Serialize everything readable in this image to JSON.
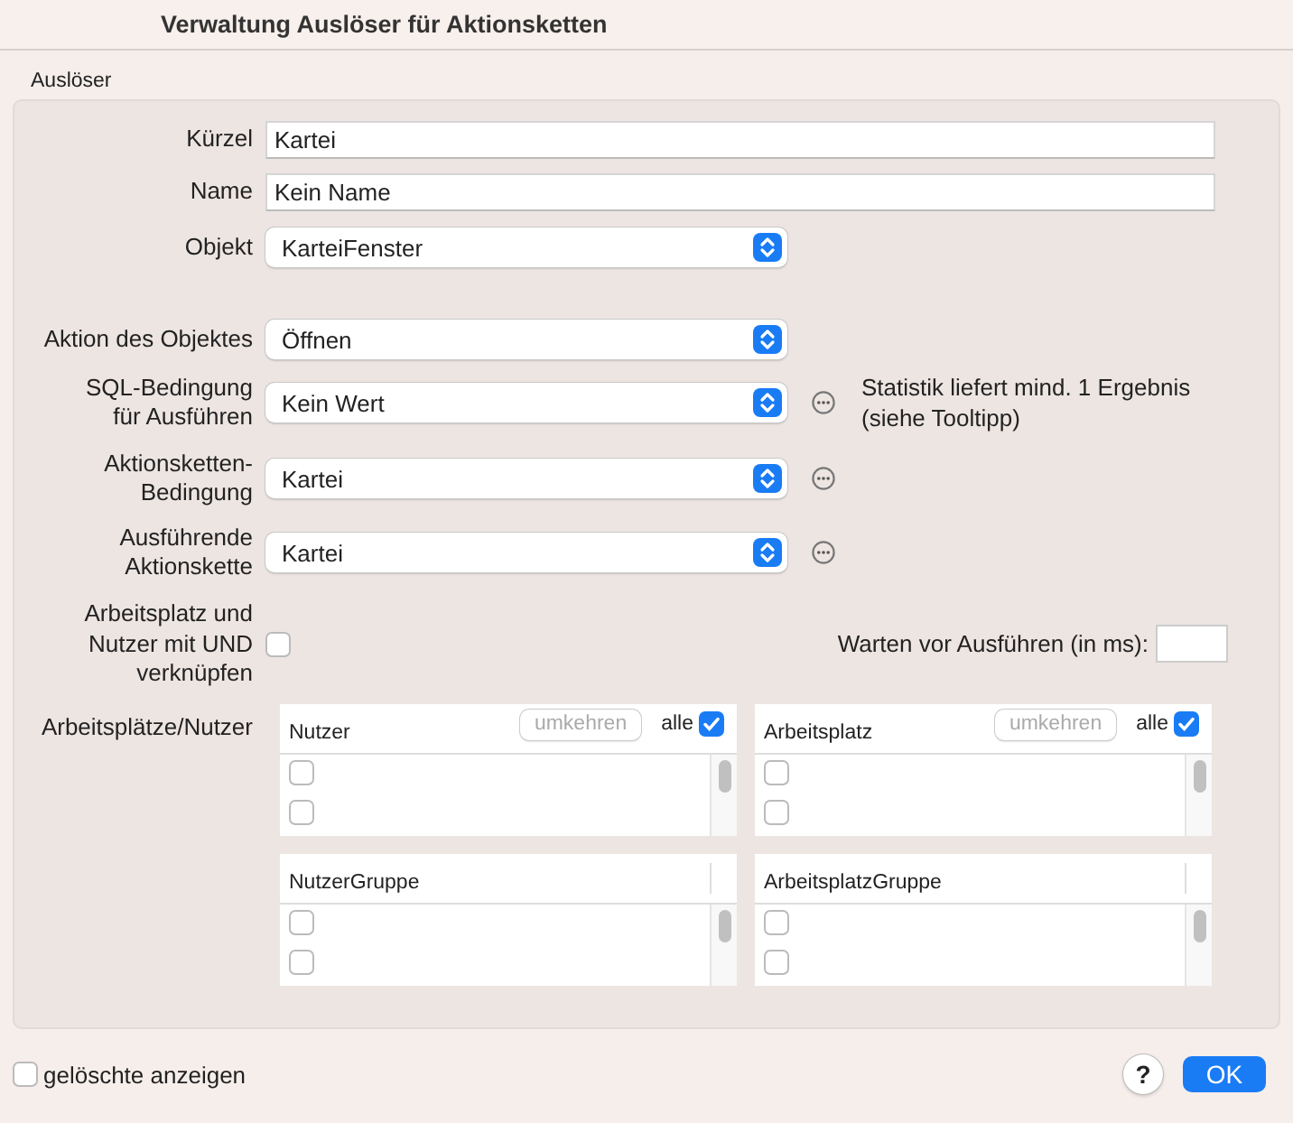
{
  "window": {
    "title": "Verwaltung Auslöser für Aktionsketten"
  },
  "section": {
    "title": "Auslöser"
  },
  "fields": [
    {
      "kind": "text",
      "label": "Kürzel",
      "value": "Kartei",
      "more_button": false
    },
    {
      "kind": "text",
      "label": "Name",
      "value": "Kein Name",
      "more_button": false
    },
    {
      "kind": "select",
      "label": "Objekt",
      "value": "KarteiFenster",
      "more_button": false
    },
    {
      "kind": "select",
      "label": "Aktion des Objektes",
      "value": "Öffnen",
      "more_button": false
    },
    {
      "kind": "select",
      "label": "SQL-Bedingung\nfür Ausführen",
      "value": "Kein Wert",
      "more_button": true,
      "note": "Statistik liefert mind. 1 Ergebnis (siehe Tooltipp)"
    },
    {
      "kind": "select",
      "label": "Aktionsketten-Bedingung",
      "value": "Kartei",
      "more_button": true
    },
    {
      "kind": "select",
      "label": "Ausführende Aktionskette",
      "value": "Kartei",
      "more_button": true
    }
  ],
  "and_option": {
    "label": "Arbeitsplatz und Nutzer mit UND verknüpfen",
    "checked": false
  },
  "wait": {
    "label": "Warten vor Ausführen (in ms):"
  },
  "lists_label": "Arbeitsplätze/Nutzer",
  "lists": [
    {
      "title": "Nutzer",
      "invert_button": {
        "label": "umkehren",
        "disabled": true
      },
      "all": {
        "label": "alle",
        "checked": true
      },
      "rows": [
        {
          "checked": false
        },
        {
          "checked": false
        }
      ]
    },
    {
      "title": "Arbeitsplatz",
      "invert_button": {
        "label": "umkehren",
        "disabled": true
      },
      "all": {
        "label": "alle",
        "checked": true
      },
      "rows": [
        {
          "checked": false
        },
        {
          "checked": false
        }
      ]
    },
    {
      "title": "NutzerGruppe",
      "rows": [
        {
          "checked": false
        },
        {
          "checked": false
        }
      ]
    },
    {
      "title": "ArbeitsplatzGruppe",
      "rows": [
        {
          "checked": false
        },
        {
          "checked": false
        }
      ]
    }
  ],
  "footer": {
    "show_deleted": {
      "label": "gelöschte anzeigen",
      "checked": false
    },
    "help": "?",
    "ok": "OK"
  }
}
